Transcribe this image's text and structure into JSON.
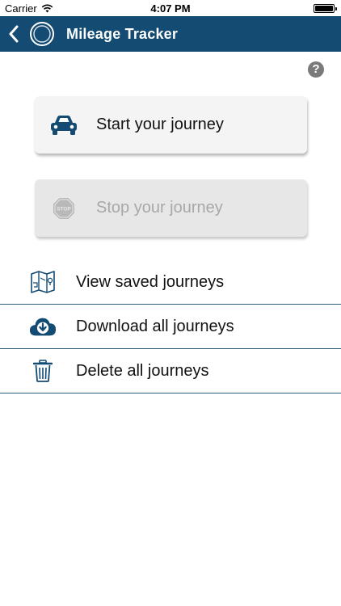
{
  "status_bar": {
    "carrier": "Carrier",
    "time": "4:07 PM"
  },
  "nav": {
    "title": "Mileage Tracker",
    "back_icon": "chevron-left-icon",
    "logo_icon": "ring-logo-icon"
  },
  "help": {
    "label": "?"
  },
  "actions": {
    "start": {
      "label": "Start your journey",
      "icon": "car-icon",
      "enabled": true
    },
    "stop": {
      "label": "Stop your journey",
      "icon": "stop-sign-icon",
      "enabled": false
    }
  },
  "list": [
    {
      "label": "View saved journeys",
      "icon": "map-icon"
    },
    {
      "label": "Download all journeys",
      "icon": "cloud-download-icon"
    },
    {
      "label": "Delete all journeys",
      "icon": "trash-icon"
    }
  ],
  "colors": {
    "brand": "#134b73",
    "card": "#f4f4f4",
    "disabled_text": "#a8a8a8",
    "divider": "#2d5d7c"
  }
}
